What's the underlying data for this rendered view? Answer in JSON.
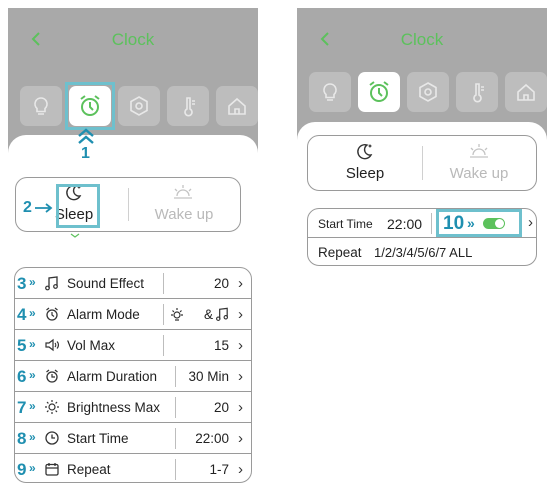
{
  "left": {
    "title": "Clock",
    "callout_1": "1",
    "callout_2": "2",
    "tabs": {
      "sleep": "Sleep",
      "wake": "Wake up"
    },
    "rows": [
      {
        "num": "3",
        "label": "Sound Effect",
        "value": "20",
        "icon": "music-note-icon"
      },
      {
        "num": "4",
        "label": "Alarm Mode",
        "value": "& ",
        "icon": "alarm-icon"
      },
      {
        "num": "5",
        "label": "Vol Max",
        "value": "15",
        "icon": "speaker-icon"
      },
      {
        "num": "6",
        "label": "Alarm Duration",
        "value": "30 Min",
        "icon": "alarm-duration-icon"
      },
      {
        "num": "7",
        "label": "Brightness Max",
        "value": "20",
        "icon": "brightness-icon"
      },
      {
        "num": "8",
        "label": "Start Time",
        "value": "22:00",
        "icon": "clock-icon"
      },
      {
        "num": "9",
        "label": "Repeat",
        "value": "1-7",
        "icon": "calendar-icon"
      }
    ]
  },
  "right": {
    "title": "Clock",
    "tabs": {
      "sleep": "Sleep",
      "wake": "Wake up"
    },
    "start_time_label": "Start Time",
    "start_time_value": "22:00",
    "callout_10": "10",
    "repeat_label": "Repeat",
    "repeat_value": "1/2/3/4/5/6/7 ALL"
  },
  "colors": {
    "accent_green": "#5cc15c",
    "callout_blue": "#1f8fb0",
    "highlight_border": "#6ec0cd"
  },
  "toggle_on": true
}
